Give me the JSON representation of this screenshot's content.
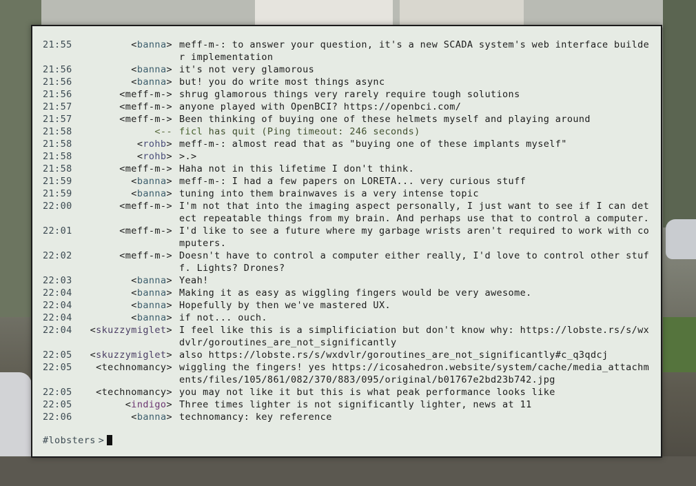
{
  "colors": {
    "terminal_background": "#e6ebe4",
    "timestamp": "#3c4a52",
    "nick_banna": "#3b5d6c",
    "nick_rohb": "#4a4d7a",
    "nick_skuzzymiglet": "#4a3d63",
    "nick_indigo": "#6a3570",
    "quit_notice": "#5a6b3f"
  },
  "messages": [
    {
      "time": "21:55",
      "nick": "banna",
      "nick_class": "nick-banna",
      "text": "meff-m-: to answer your question, it's a new SCADA system's web interface builder implementation"
    },
    {
      "time": "21:56",
      "nick": "banna",
      "nick_class": "nick-banna",
      "text": "it's not very glamorous"
    },
    {
      "time": "21:56",
      "nick": "banna",
      "nick_class": "nick-banna",
      "text": "but! you do write most things async"
    },
    {
      "time": "21:56",
      "nick": "meff-m-",
      "nick_class": "nick-meff",
      "text": "shrug glamorous things very rarely require tough solutions"
    },
    {
      "time": "21:57",
      "nick": "meff-m-",
      "nick_class": "nick-meff",
      "text": "anyone played with OpenBCI? https://openbci.com/"
    },
    {
      "time": "21:57",
      "nick": "meff-m-",
      "nick_class": "nick-meff",
      "text": "Been thinking of buying one of these helmets myself and playing around"
    },
    {
      "time": "21:58",
      "type": "quit",
      "arrow": "<--",
      "quit_nick": "ficl",
      "text": "has quit (Ping timeout: 246 seconds)"
    },
    {
      "time": "21:58",
      "nick": "rohb",
      "nick_class": "nick-rohb",
      "text": "meff-m-: almost read that as \"buying one of these implants myself\""
    },
    {
      "time": "21:58",
      "nick": "rohb",
      "nick_class": "nick-rohb",
      "text": ">.>"
    },
    {
      "time": "21:58",
      "nick": "meff-m-",
      "nick_class": "nick-meff",
      "text": "Haha not in this lifetime I don't think."
    },
    {
      "time": "21:59",
      "nick": "banna",
      "nick_class": "nick-banna",
      "text": "meff-m-: I had a few papers on LORETA... very curious stuff"
    },
    {
      "time": "21:59",
      "nick": "banna",
      "nick_class": "nick-banna",
      "text": "tuning into them brainwaves is a very intense topic"
    },
    {
      "time": "22:00",
      "nick": "meff-m-",
      "nick_class": "nick-meff",
      "text": "I'm not that into the imaging aspect personally, I just want to see if I can detect repeatable things from my brain. And perhaps use that to control a computer."
    },
    {
      "time": "22:01",
      "nick": "meff-m-",
      "nick_class": "nick-meff",
      "text": "I'd like to see a future where my garbage wrists aren't required to work with computers."
    },
    {
      "time": "22:02",
      "nick": "meff-m-",
      "nick_class": "nick-meff",
      "text": "Doesn't have to control a computer either really, I'd love to control other stuff. Lights? Drones?"
    },
    {
      "time": "22:03",
      "nick": "banna",
      "nick_class": "nick-banna",
      "text": "Yeah!"
    },
    {
      "time": "22:04",
      "nick": "banna",
      "nick_class": "nick-banna",
      "text": "Making it as easy as wiggling fingers would be very awesome."
    },
    {
      "time": "22:04",
      "nick": "banna",
      "nick_class": "nick-banna",
      "text": "Hopefully by then we've mastered UX."
    },
    {
      "time": "22:04",
      "nick": "banna",
      "nick_class": "nick-banna",
      "text": "if not... ouch."
    },
    {
      "time": "22:04",
      "nick": "skuzzymiglet",
      "nick_class": "nick-skuzzy",
      "text": "I feel like this is a simplificiation but don't know why: https://lobste.rs/s/wxdvlr/goroutines_are_not_significantly"
    },
    {
      "time": "22:05",
      "nick": "skuzzymiglet",
      "nick_class": "nick-skuzzy",
      "text": "also https://lobste.rs/s/wxdvlr/goroutines_are_not_significantly#c_q3qdcj"
    },
    {
      "time": "22:05",
      "nick": "technomancy",
      "nick_class": "nick-techno",
      "text": "wiggling the fingers! yes https://icosahedron.website/system/cache/media_attachments/files/105/861/082/370/883/095/original/b01767e2bd23b742.jpg"
    },
    {
      "time": "22:05",
      "nick": "technomancy",
      "nick_class": "nick-techno",
      "text": "you may not like it but this is what peak performance looks like"
    },
    {
      "time": "22:05",
      "nick": "indigo",
      "nick_class": "nick-indigo",
      "text": "Three times lighter is not significantly lighter, news at 11"
    },
    {
      "time": "22:06",
      "nick": "banna",
      "nick_class": "nick-banna",
      "text": "technomancy: key reference"
    }
  ],
  "prompt": {
    "channel": "#lobsters",
    "separator": ">"
  }
}
